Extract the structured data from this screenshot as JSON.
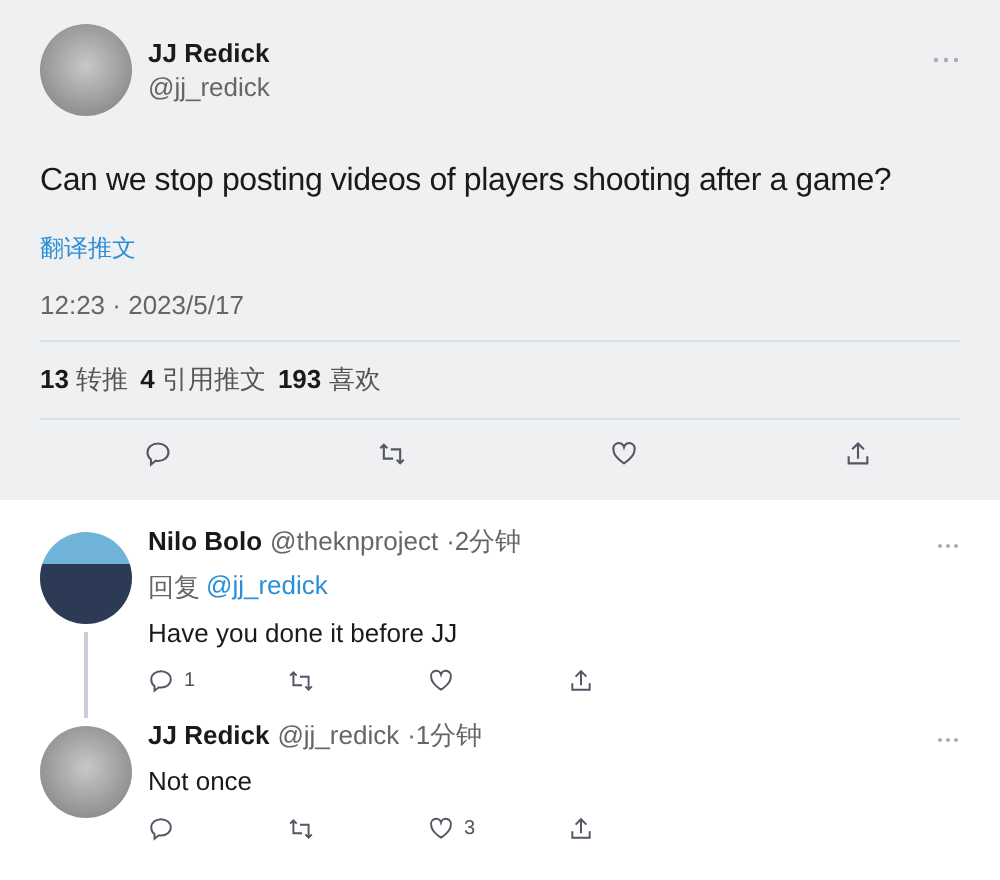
{
  "tweet": {
    "author": {
      "name": "JJ Redick",
      "handle": "@jj_redick"
    },
    "text": "Can we stop posting videos of players shooting after a game?",
    "translate": "翻译推文",
    "timestamp": "12:23 · 2023/5/17",
    "stats": [
      {
        "count": "13",
        "label": "转推"
      },
      {
        "count": "4",
        "label": "引用推文"
      },
      {
        "count": "193",
        "label": "喜欢"
      }
    ],
    "actions": [
      {
        "kind": "reply"
      },
      {
        "kind": "retweet"
      },
      {
        "kind": "like"
      },
      {
        "kind": "share"
      }
    ]
  },
  "replies": [
    {
      "name": "Nilo Bolo",
      "handle": "@theknproject",
      "time": "·2分钟",
      "reply_to": {
        "prefix": "回复",
        "handle": "@jj_redick"
      },
      "text": "Have you done it before JJ",
      "actions": [
        {
          "kind": "reply",
          "count": "1"
        },
        {
          "kind": "retweet"
        },
        {
          "kind": "like"
        },
        {
          "kind": "share"
        }
      ]
    },
    {
      "name": "JJ Redick",
      "handle": "@jj_redick",
      "time": "·1分钟",
      "text": "Not once",
      "actions": [
        {
          "kind": "reply"
        },
        {
          "kind": "retweet"
        },
        {
          "kind": "like",
          "count": "3"
        },
        {
          "kind": "share"
        }
      ]
    }
  ]
}
